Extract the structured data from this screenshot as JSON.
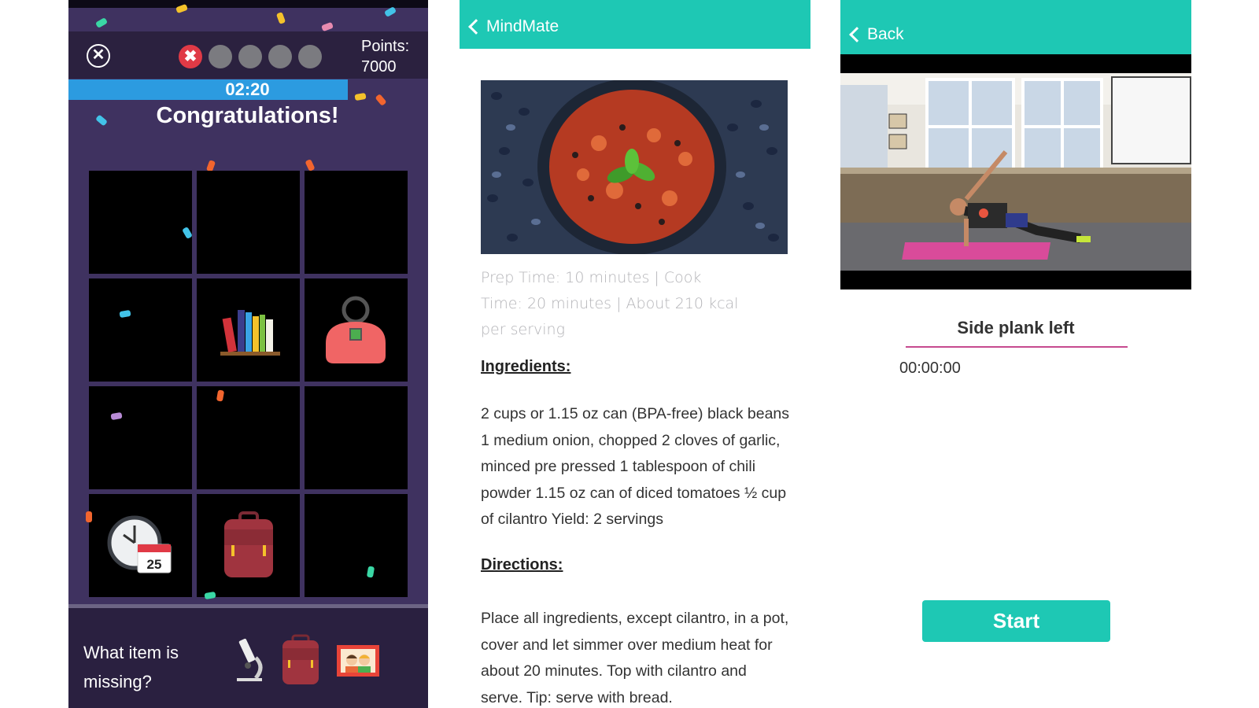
{
  "game": {
    "close_icon": "x-circle-icon",
    "progress": [
      "fail",
      "empty",
      "empty",
      "empty",
      "empty"
    ],
    "points_label": "Points:",
    "points_value": "7000",
    "timer": "02:20",
    "title": "Congratulations!",
    "grid_items": [
      {
        "row": 1,
        "col": 1,
        "icon": ""
      },
      {
        "row": 1,
        "col": 2,
        "icon": ""
      },
      {
        "row": 1,
        "col": 3,
        "icon": ""
      },
      {
        "row": 2,
        "col": 1,
        "icon": ""
      },
      {
        "row": 2,
        "col": 2,
        "icon": "books-icon"
      },
      {
        "row": 2,
        "col": 3,
        "icon": "handbag-icon"
      },
      {
        "row": 3,
        "col": 1,
        "icon": ""
      },
      {
        "row": 3,
        "col": 2,
        "icon": ""
      },
      {
        "row": 3,
        "col": 3,
        "icon": ""
      },
      {
        "row": 4,
        "col": 1,
        "icon": "clock-calendar-icon"
      },
      {
        "row": 4,
        "col": 2,
        "icon": "backpack-icon"
      },
      {
        "row": 4,
        "col": 3,
        "icon": ""
      }
    ],
    "calendar_day": "25",
    "question": "What item is missing?",
    "options": [
      "microscope-icon",
      "backpack-icon",
      "family-photo-icon"
    ]
  },
  "recipe": {
    "nav_title": "MindMate",
    "image_icon": "black-bean-chili-photo",
    "meta": "Prep Time: 10 minutes | Cook Time: 20 minutes | About 210 kcal per serving",
    "ingredients_heading": "Ingredients:",
    "ingredients_text": "2 cups or 1.15 oz can (BPA-free) black beans 1 medium onion, chopped 2 cloves of garlic, minced pre pressed 1 tablespoon of chili powder 1.15 oz can of diced tomatoes ½ cup of cilantro Yield: 2 servings",
    "directions_heading": "Directions:",
    "directions_text": "Place all ingredients, except cilantro, in a pot, cover and let simmer over medium heat for about 20 minutes. Top with cilantro and serve. Tip: serve with bread."
  },
  "exercise": {
    "back_label": "Back",
    "video_icon": "side-plank-video-frame",
    "exercise_name": "Side plank left",
    "elapsed": "00:00:00",
    "start_label": "Start"
  },
  "colors": {
    "teal": "#1ec8b4",
    "game_bg": "#3f3260",
    "timer_blue": "#2c9be0",
    "fail_red": "#e03a46",
    "underline_pink": "#c64a8f"
  }
}
